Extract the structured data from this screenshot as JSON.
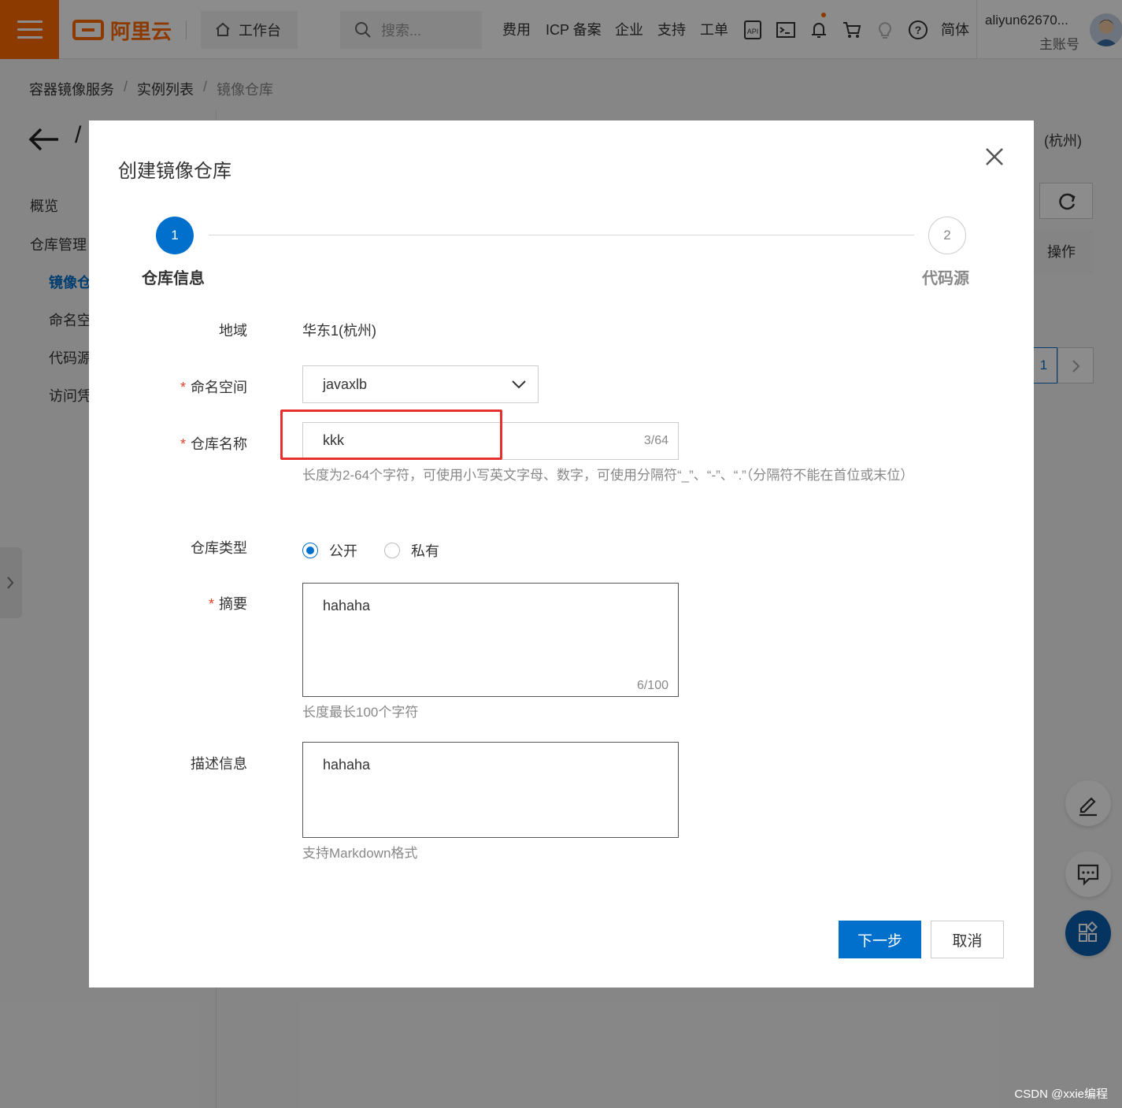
{
  "topbar": {
    "workbench_label": "工作台",
    "search_placeholder": "搜索...",
    "nav": [
      "费用",
      "ICP 备案",
      "企业",
      "支持",
      "工单"
    ],
    "lang": "简体",
    "user_name": "aliyun62670...",
    "user_role": "主账号"
  },
  "logo_text": "阿里云",
  "breadcrumb": [
    "容器镜像服务",
    "实例列表",
    "镜像仓库"
  ],
  "page": {
    "region_suffix": "(杭州)",
    "op_header": "操作",
    "page_number": "1"
  },
  "sidebar": {
    "items": [
      {
        "label": "概览"
      },
      {
        "label": "仓库管理"
      },
      {
        "label": "镜像仓"
      },
      {
        "label": "命名空"
      },
      {
        "label": "代码源"
      },
      {
        "label": "访问凭"
      }
    ]
  },
  "dialog": {
    "title": "创建镜像仓库",
    "steps": [
      {
        "num": "1",
        "label": "仓库信息"
      },
      {
        "num": "2",
        "label": "代码源"
      }
    ],
    "region_label": "地域",
    "region_value": "华东1(杭州)",
    "namespace_label": "命名空间",
    "namespace_value": "javaxlb",
    "repo_name_label": "仓库名称",
    "repo_name_value": "kkk",
    "repo_name_count": "3/64",
    "repo_name_hint": "长度为2-64个字符，可使用小写英文字母、数字，可使用分隔符“_”、“-”、“.”（分隔符不能在首位或末位）",
    "repo_type_label": "仓库类型",
    "repo_type_options": [
      {
        "label": "公开",
        "selected": true
      },
      {
        "label": "私有",
        "selected": false
      }
    ],
    "summary_label": "摘要",
    "summary_value": "hahaha",
    "summary_count": "6/100",
    "summary_hint": "长度最长100个字符",
    "desc_label": "描述信息",
    "desc_value": "hahaha",
    "desc_hint": "支持Markdown格式",
    "next_label": "下一步",
    "cancel_label": "取消"
  },
  "watermark": "CSDN @xxie编程",
  "colors": {
    "brand": "#ff6a00",
    "primary": "#0070cc",
    "highlight": "#e53030"
  }
}
